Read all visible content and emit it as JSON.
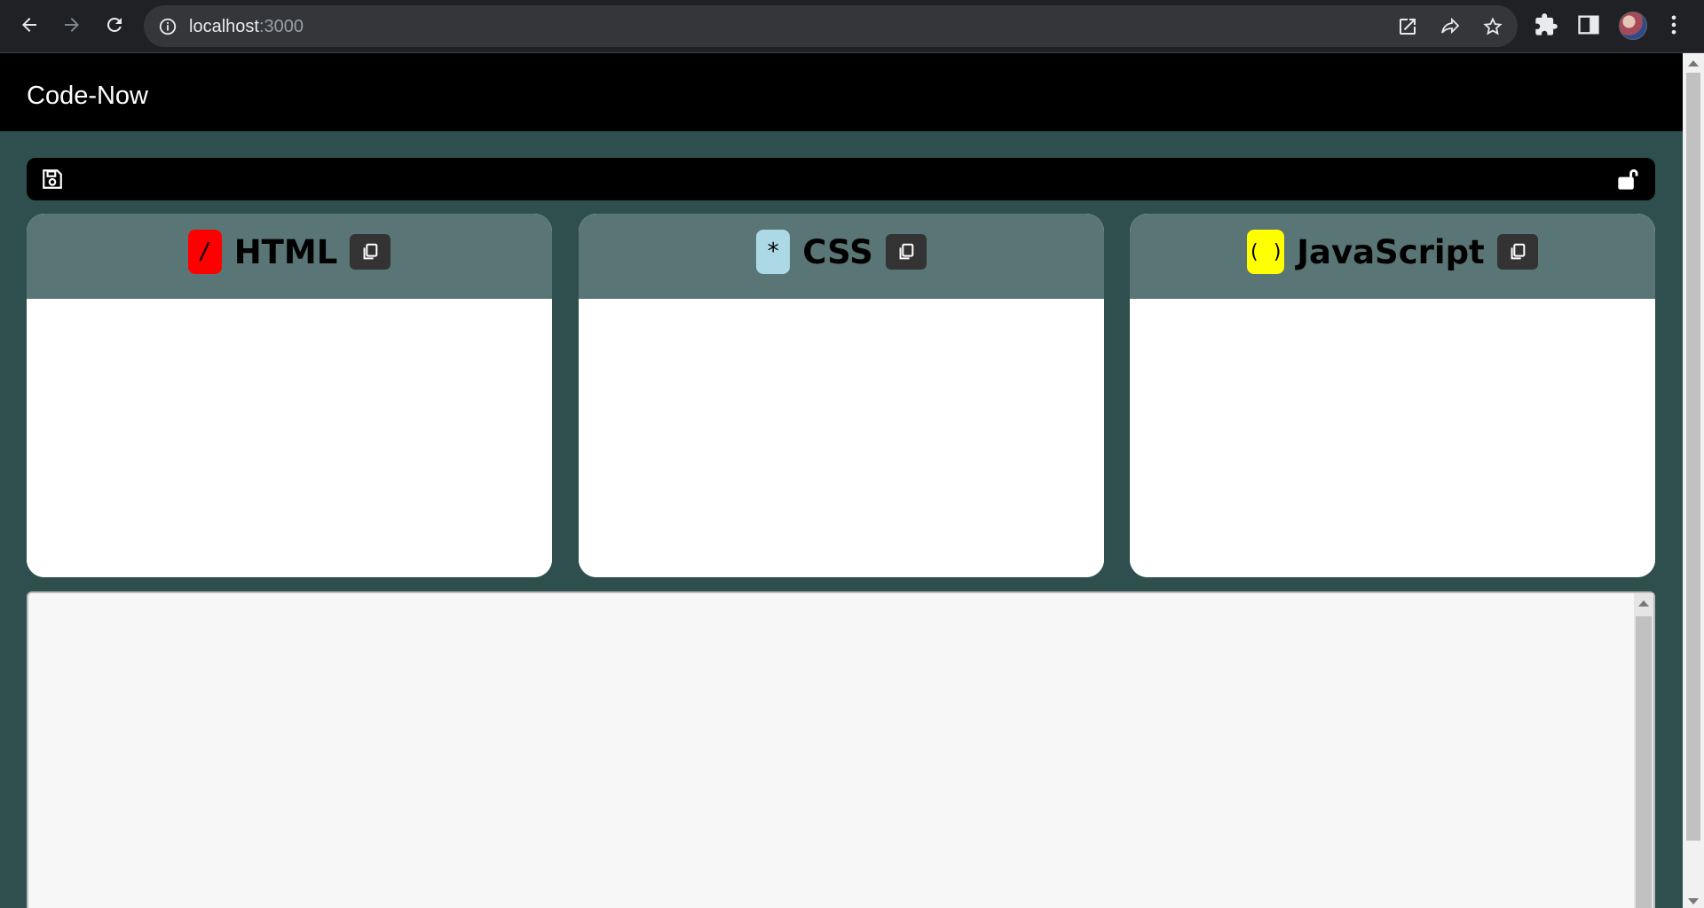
{
  "browser": {
    "url_host": "localhost",
    "url_port": ":3000",
    "icons": [
      "back-arrow-icon",
      "forward-arrow-icon",
      "reload-icon",
      "site-info-icon",
      "open-in-new-icon",
      "share-icon",
      "bookmark-star-icon",
      "extensions-puzzle-icon",
      "side-panel-icon",
      "profile-avatar",
      "more-vert-icon"
    ]
  },
  "app": {
    "title": "Code-Now",
    "colors": {
      "header": "#000000",
      "background": "#2f4f4f",
      "panel_header": "#5a7575"
    }
  },
  "toolbar": {
    "icons": [
      "save-icon",
      "unlock-icon"
    ]
  },
  "editors": [
    {
      "name": "HTML",
      "badge": "/",
      "badge_color": "#ff0000"
    },
    {
      "name": "CSS",
      "badge": "*",
      "badge_color": "#add8e6"
    },
    {
      "name": "JavaScript",
      "badge": "( )",
      "badge_color": "#ffff00"
    }
  ],
  "output": {}
}
